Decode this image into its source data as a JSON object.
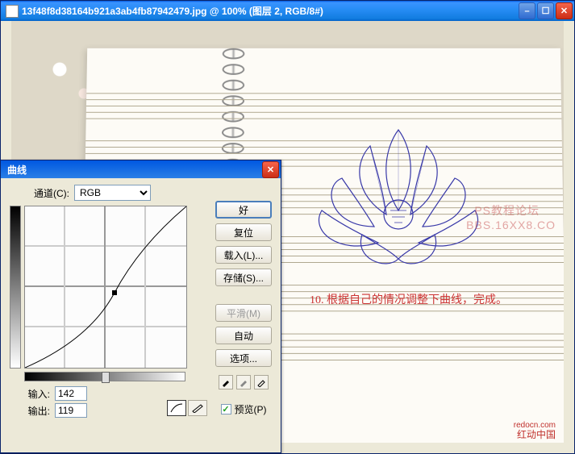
{
  "main_window": {
    "title": "13f48f8d38164b921a3ab4fb87942479.jpg @ 100% (图层 2, RGB/8#)"
  },
  "annotation": {
    "step_text": "10. 根据自己的情况调整下曲线，完成。"
  },
  "watermark": {
    "line1": "PS教程论坛",
    "line2": "BBS.16XX8.CO"
  },
  "redocn": {
    "brand": "红动中国",
    "url": "redocn.com"
  },
  "curves": {
    "title": "曲线",
    "channel_label": "通道(C):",
    "channel_value": "RGB",
    "input_label": "输入:",
    "input_value": "142",
    "output_label": "输出:",
    "output_value": "119",
    "buttons": {
      "ok": "好",
      "reset": "复位",
      "load": "载入(L)...",
      "save": "存储(S)...",
      "smooth": "平滑(M)",
      "auto": "自动",
      "options": "选项..."
    },
    "preview_label": "预览(P)",
    "preview_checked": true
  },
  "chart_data": {
    "type": "line",
    "title": "曲线",
    "xlabel": "输入",
    "ylabel": "输出",
    "xlim": [
      0,
      255
    ],
    "ylim": [
      0,
      255
    ],
    "series": [
      {
        "name": "RGB",
        "points": [
          [
            0,
            0
          ],
          [
            142,
            119
          ],
          [
            255,
            255
          ]
        ],
        "shape": "curve"
      }
    ],
    "active_point": {
      "input": 142,
      "output": 119
    }
  }
}
